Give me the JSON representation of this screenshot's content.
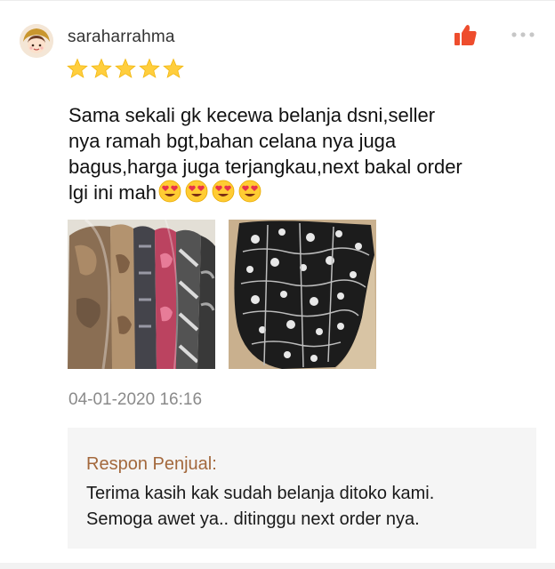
{
  "review": {
    "username": "saraharrahma",
    "rating": 5,
    "rating_max": 5,
    "comment": "Sama sekali gk kecewa belanja dsni,seller\nnya ramah bgt,bahan celana nya juga\nbagus,harga juga terjangkau,next bakal order\nlgi ini mah",
    "emoji": [
      "heart-eyes-emoji",
      "heart-eyes-emoji",
      "heart-eyes-emoji",
      "heart-eyes-emoji"
    ],
    "photos": [
      "photo-packaged-pants",
      "photo-batik-pants"
    ],
    "timestamp": "04-01-2020 16:16"
  },
  "actions": {
    "like_icon": "thumbs-up-icon",
    "more_icon": "more-dots-icon"
  },
  "seller_response": {
    "title": "Respon Penjual:",
    "text": "Terima kasih kak sudah belanja ditoko kami.\nSemoga awet ya.. ditinggu next order nya."
  },
  "colors": {
    "accent": "#ee4d2d",
    "star": "#ffce3d",
    "seller_title": "#a3683c",
    "timestamp": "#8a8a8a",
    "seller_box_bg": "#f5f5f5"
  }
}
